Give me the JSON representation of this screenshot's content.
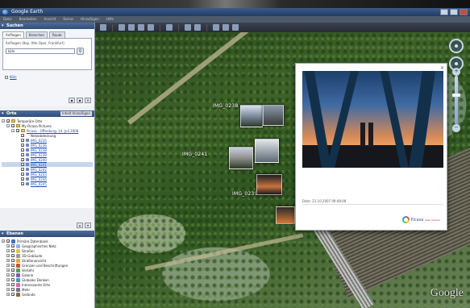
{
  "window": {
    "title": "Google Earth"
  },
  "menu": [
    "Datei",
    "Bearbeiten",
    "Ansicht",
    "Extras",
    "Hinzufügen",
    "Hilfe"
  ],
  "sidebar": {
    "search": {
      "header": "Suchen",
      "tabs": [
        "Anfliegen",
        "Branchen",
        "Route"
      ],
      "hint": "Anfliegen (Bsp. Alte Oper, Frankfurt)",
      "query": "köln",
      "result": "Köln"
    },
    "places": {
      "header": "Orte",
      "extra": "Inhalt hinzufügen",
      "items": [
        {
          "label": "Temporäre Orte",
          "indent": 0,
          "type": "folder"
        },
        {
          "label": "My Picasa Pictures",
          "indent": 1,
          "type": "folder"
        },
        {
          "label": "Picasa - Offenburg, 14. Juli 2008",
          "indent": 2,
          "type": "folder",
          "link": true
        },
        {
          "label": "Netzabdeckung",
          "indent": 3,
          "type": "text"
        },
        {
          "label": "IMG_0235",
          "indent": 3,
          "type": "pin",
          "link": true
        },
        {
          "label": "IMG_0236",
          "indent": 3,
          "type": "pin",
          "link": true
        },
        {
          "label": "IMG_0238",
          "indent": 3,
          "type": "pin",
          "link": true
        },
        {
          "label": "IMG_0239",
          "indent": 3,
          "type": "pin",
          "link": true
        },
        {
          "label": "IMG_0240",
          "indent": 3,
          "type": "pin",
          "link": true
        },
        {
          "label": "IMG_0241",
          "indent": 3,
          "type": "pin",
          "link": true,
          "selected": true
        },
        {
          "label": "IMG_0242",
          "indent": 3,
          "type": "pin",
          "link": true
        },
        {
          "label": "IMG_0243",
          "indent": 3,
          "type": "pin",
          "link": true
        },
        {
          "label": "IMG_0244",
          "indent": 3,
          "type": "pin",
          "link": true
        },
        {
          "label": "IMG_0245",
          "indent": 3,
          "type": "pin",
          "link": true
        }
      ]
    },
    "layers": {
      "header": "Ebenen",
      "items": [
        {
          "label": "Primäre Datenbank",
          "color": "#3f73c9"
        },
        {
          "label": "Geographisches Netz",
          "color": "#8bb7e8"
        },
        {
          "label": "Straßen",
          "color": "#e8c14a"
        },
        {
          "label": "3D-Gebäude",
          "color": "#9a9a9a"
        },
        {
          "label": "Straßenansicht",
          "color": "#f2a43a"
        },
        {
          "label": "Grenzen und Beschriftungen",
          "color": "#c9503c"
        },
        {
          "label": "Verkehr",
          "color": "#4da34a"
        },
        {
          "label": "Galerie",
          "color": "#7a5bc2"
        },
        {
          "label": "Globales Denken",
          "color": "#3aa0a8"
        },
        {
          "label": "Interessante Orte",
          "color": "#d86aa3"
        },
        {
          "label": "Mehr",
          "color": "#6b7b8f"
        },
        {
          "label": "Gelände",
          "color": "#8a6b3d"
        }
      ]
    }
  },
  "map": {
    "placemarks": [
      "IMG_0238",
      "IMG_0241",
      "IMG_0239"
    ],
    "balloon": {
      "date": "Date: 21.10.2007 09:48:09",
      "logo": "Picasa",
      "logo_tag": "Web Albums"
    },
    "logo": "Google"
  }
}
